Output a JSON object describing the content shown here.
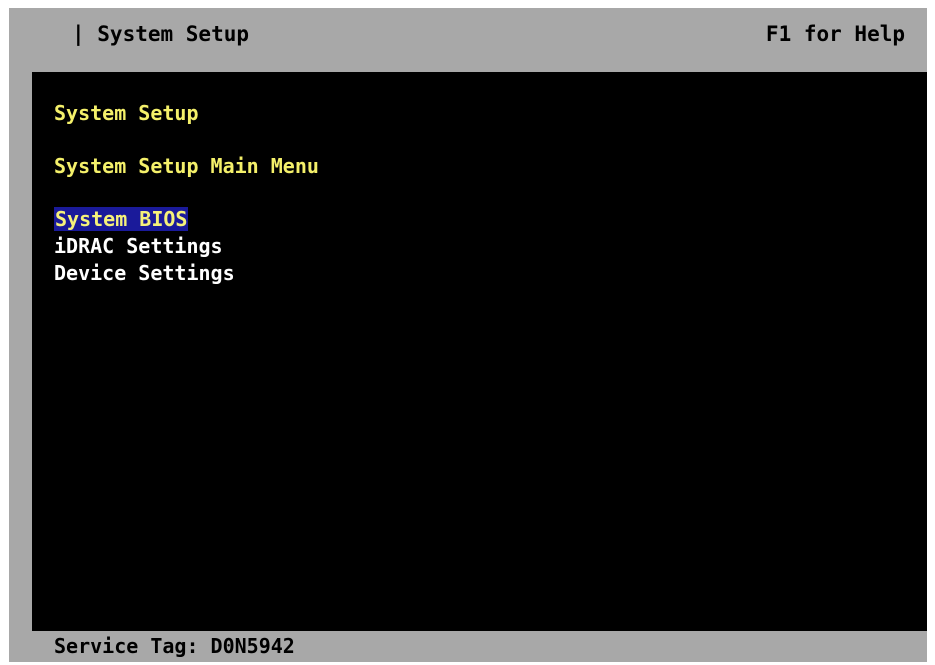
{
  "header": {
    "title": "| System Setup",
    "help": "F1 for Help"
  },
  "main": {
    "heading": "System Setup",
    "subheading": "System Setup Main Menu",
    "menu": [
      {
        "label": "System BIOS",
        "selected": true
      },
      {
        "label": "iDRAC Settings",
        "selected": false
      },
      {
        "label": "Device Settings",
        "selected": false
      }
    ]
  },
  "footer": {
    "service_tag": "Service Tag: D0N5942"
  },
  "colors": {
    "frame": "#a8a8a8",
    "panel": "#000000",
    "heading": "#f4f06a",
    "menu_text": "#ffffff",
    "selection_bg": "#1a1a9a"
  }
}
